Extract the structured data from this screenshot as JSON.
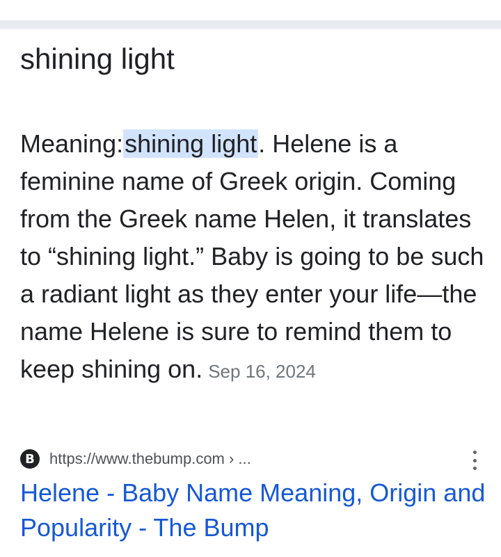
{
  "answer": {
    "title": "shining light",
    "meaning_prefix": "Meaning:",
    "meaning_highlight": "shining light",
    "body": ". Helene is a feminine name of Greek origin. Coming from the Greek name Helen, it translates to “shining light.” Baby is going to be such a radiant light as they enter your life—the name Helene is sure to remind them to keep shining on.",
    "date": "Sep 16, 2024"
  },
  "source": {
    "favicon_letter": "B",
    "favicon_icon": "thebump-favicon-icon",
    "url": "https://www.thebump.com › ...",
    "more_icon": "more-vert-icon"
  },
  "result": {
    "title": "Helene - Baby Name Meaning, Origin and Popularity - The Bump",
    "link_color": "#1558d6"
  },
  "colors": {
    "highlight": "#d2e3fc",
    "divider": "#e8ebef",
    "text": "#202124",
    "muted": "#70757a"
  }
}
